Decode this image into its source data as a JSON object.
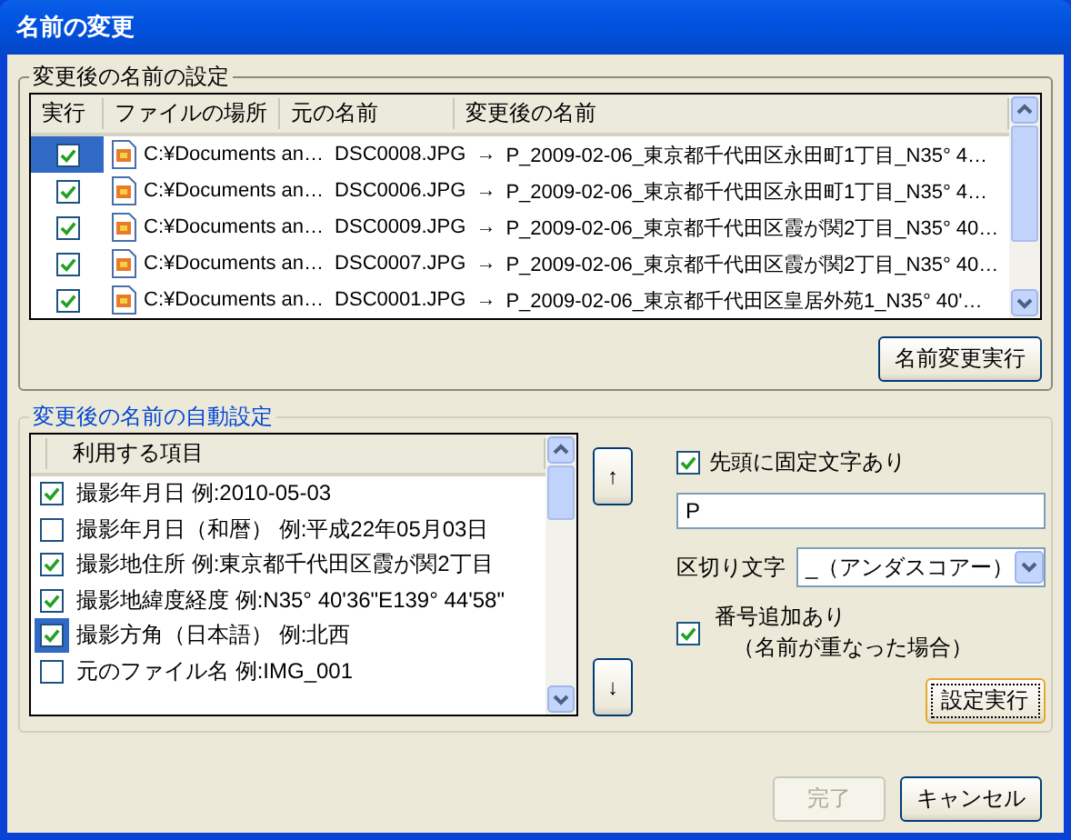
{
  "window": {
    "title": "名前の変更"
  },
  "rename_settings": {
    "title": "変更後の名前の設定",
    "columns": [
      "実行",
      "ファイルの場所",
      "元の名前",
      "変更後の名前"
    ],
    "rows": [
      {
        "checked": true,
        "selected": true,
        "location": "C:¥Documents an…",
        "original": "DSC0008.JPG",
        "arrow": "→",
        "new_name": "P_2009-02-06_東京都千代田区永田町1丁目_N35° 4…"
      },
      {
        "checked": true,
        "selected": false,
        "location": "C:¥Documents an…",
        "original": "DSC0006.JPG",
        "arrow": "→",
        "new_name": "P_2009-02-06_東京都千代田区永田町1丁目_N35° 4…"
      },
      {
        "checked": true,
        "selected": false,
        "location": "C:¥Documents an…",
        "original": "DSC0009.JPG",
        "arrow": "→",
        "new_name": "P_2009-02-06_東京都千代田区霞が関2丁目_N35° 40…"
      },
      {
        "checked": true,
        "selected": false,
        "location": "C:¥Documents an…",
        "original": "DSC0007.JPG",
        "arrow": "→",
        "new_name": "P_2009-02-06_東京都千代田区霞が関2丁目_N35° 40…"
      },
      {
        "checked": true,
        "selected": false,
        "location": "C:¥Documents an…",
        "original": "DSC0001.JPG",
        "arrow": "→",
        "new_name": "P_2009-02-06_東京都千代田区皇居外苑1_N35° 40'…"
      }
    ],
    "execute_button": "名前変更実行"
  },
  "auto_settings": {
    "title": "変更後の名前の自動設定",
    "list_header": "利用する項目",
    "items": [
      {
        "label": "撮影年月日  例:2010-05-03",
        "checked": true,
        "selected": false
      },
      {
        "label": "撮影年月日（和暦） 例:平成22年05月03日",
        "checked": false,
        "selected": false
      },
      {
        "label": "撮影地住所  例:東京都千代田区霞が関2丁目",
        "checked": true,
        "selected": false
      },
      {
        "label": "撮影地緯度経度  例:N35° 40'36\"E139° 44'58\"",
        "checked": true,
        "selected": false
      },
      {
        "label": "撮影方角（日本語） 例:北西",
        "checked": true,
        "selected": true
      },
      {
        "label": "元のファイル名  例:IMG_001",
        "checked": false,
        "selected": false
      }
    ],
    "up_button": "↑",
    "down_button": "↓",
    "prefix": {
      "label": "先頭に固定文字あり",
      "checked": true,
      "value": "P"
    },
    "separator": {
      "label": "区切り文字",
      "value": "_（アンダスコアー）"
    },
    "numbering": {
      "label": "番号追加あり",
      "note": "（名前が重なった場合）",
      "checked": true
    },
    "apply_button": "設定実行"
  },
  "buttons": [
    {
      "label": "完了",
      "disabled": true
    },
    {
      "label": "キャンセル",
      "disabled": false
    }
  ]
}
